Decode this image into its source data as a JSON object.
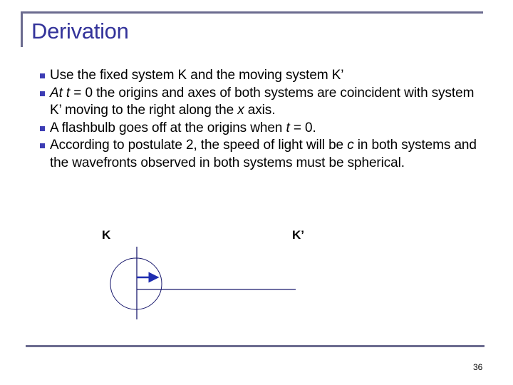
{
  "slide": {
    "title": "Derivation",
    "page_number": "36",
    "accent_color": "#33339a",
    "frame_color": "#6b6b8f",
    "bullet_color": "#3c3cb4"
  },
  "bullets": [
    {
      "parts": [
        {
          "text": "Use the fixed system K and the moving system K’",
          "italic": false
        }
      ]
    },
    {
      "parts": [
        {
          "text": "At t",
          "italic": true
        },
        {
          "text": " = 0 the origins and axes of both systems are coincident with system K’ moving to the right along the ",
          "italic": false
        },
        {
          "text": "x",
          "italic": true
        },
        {
          "text": " axis.",
          "italic": false
        }
      ]
    },
    {
      "parts": [
        {
          "text": "A flashbulb goes off at the origins when ",
          "italic": false
        },
        {
          "text": "t",
          "italic": true
        },
        {
          "text": " = 0.",
          "italic": false
        }
      ]
    },
    {
      "parts": [
        {
          "text": "According to postulate 2, the speed of light will be ",
          "italic": false
        },
        {
          "text": "c",
          "italic": true
        },
        {
          "text": " in both systems and the wavefronts observed in both systems must be spherical.",
          "italic": false
        }
      ]
    }
  ],
  "diagram": {
    "label_fixed": "K",
    "label_moving": "K’",
    "line_color": "#1a1a6e",
    "arrow_color": "#1f2db0"
  }
}
